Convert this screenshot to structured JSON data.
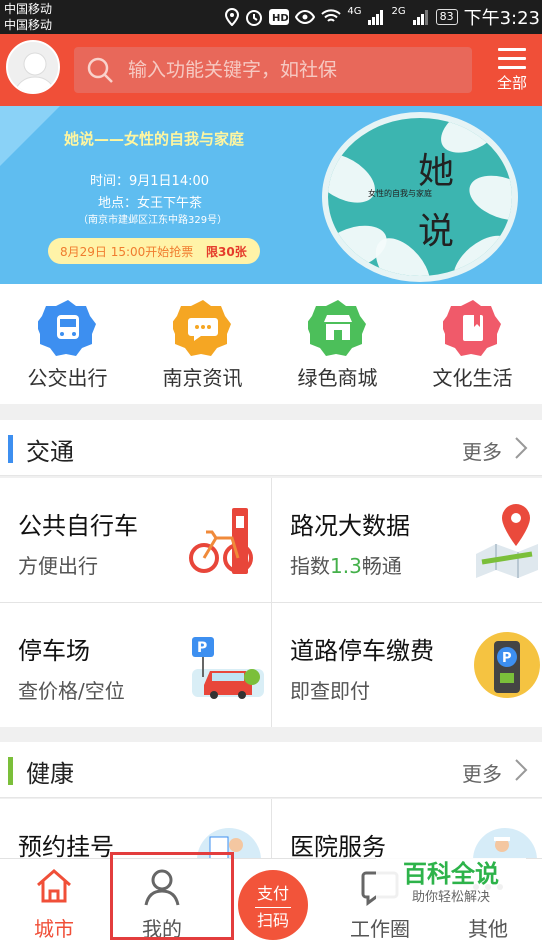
{
  "status_bar": {
    "carrier_1": "中国移动",
    "carrier_2": "中国移动",
    "signal_1": "4G",
    "signal_2": "2G",
    "battery": "83",
    "time": "下午3:23"
  },
  "header": {
    "search_placeholder": "输入功能关键字，如社保",
    "menu_label": "全部"
  },
  "banner": {
    "title": "她说——女性的自我与家庭",
    "time": "时间：9月1日14:00",
    "place": "地点：女王下午茶",
    "address": "（南京市建邺区江东中路329号）",
    "ticket_start": "8月29日 15:00开始抢票",
    "limit": "限30张",
    "poster_big_1": "她",
    "poster_big_2": "说",
    "poster_sub": "女性的自我与家庭"
  },
  "services": [
    {
      "label": "公交出行",
      "icon": "bus-icon",
      "color": "#3d8ff0"
    },
    {
      "label": "南京资讯",
      "icon": "chat-icon",
      "color": "#f5a623"
    },
    {
      "label": "绿色商城",
      "icon": "shop-icon",
      "color": "#4cbf5a"
    },
    {
      "label": "文化生活",
      "icon": "book-icon",
      "color": "#f05a6a"
    }
  ],
  "sections": {
    "traffic": {
      "title": "交通",
      "more": "更多",
      "mark_color": "#3d8ff0",
      "tiles": [
        {
          "title": "公共自行车",
          "subtitle": "方便出行"
        },
        {
          "title": "路况大数据",
          "subtitle_prefix": "指数",
          "subtitle_value": "1.3",
          "subtitle_suffix": "畅通"
        },
        {
          "title": "停车场",
          "subtitle": "查价格/空位"
        },
        {
          "title": "道路停车缴费",
          "subtitle": "即查即付"
        }
      ]
    },
    "health": {
      "title": "健康",
      "more": "更多",
      "mark_color": "#7bbf3a",
      "tiles": [
        {
          "title": "预约挂号"
        },
        {
          "title": "医院服务"
        }
      ]
    }
  },
  "bottom_nav": {
    "items": [
      {
        "label": "城市",
        "icon": "home-icon"
      },
      {
        "label": "我的",
        "icon": "person-icon"
      },
      {
        "label": "工作圈",
        "icon": "chat-bubble-icon"
      },
      {
        "label": "其他",
        "icon": "more-icon"
      }
    ],
    "pay_line1": "支付",
    "pay_line2": "扫码",
    "active_color": "#f04f38"
  },
  "watermark": {
    "line1": "百科全说",
    "line2": "助你轻松解决"
  }
}
